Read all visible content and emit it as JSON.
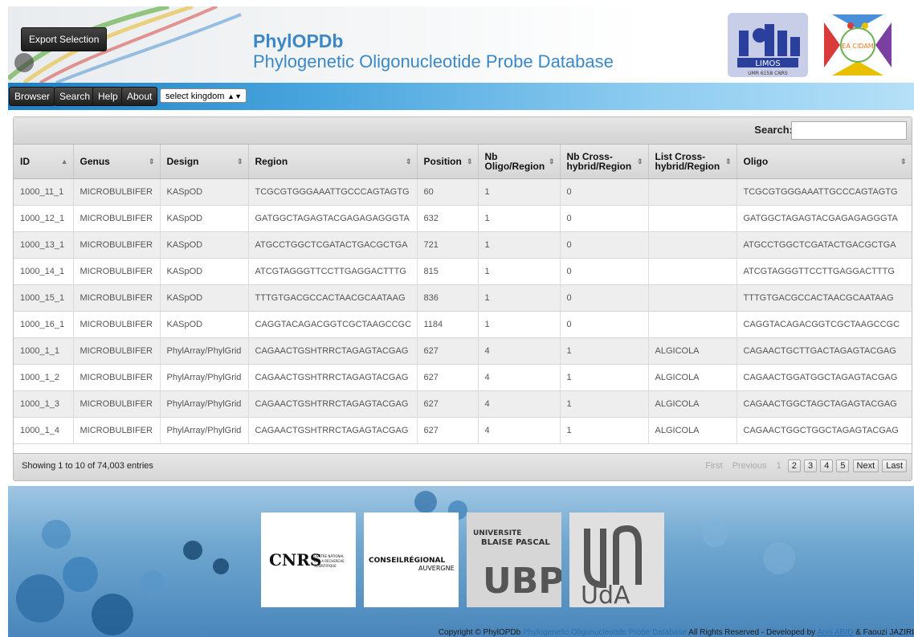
{
  "header": {
    "export_label": "Export Selection",
    "title": "PhylOPDb",
    "subtitle": "Phylogenetic Oligonucleotide Probe Database",
    "limos_text": "LIMOS",
    "limos_sub": "UMR 6158 CNRS",
    "ea_text": "EA CIDAM"
  },
  "nav": {
    "items": [
      "Browser",
      "Search",
      "Help",
      "About"
    ],
    "kingdom_select": "select kingdom"
  },
  "table": {
    "search_label": "Search:",
    "columns": [
      "ID",
      "Genus",
      "Design",
      "Region",
      "Position",
      "Nb Oligo/Region",
      "Nb Cross-hybrid/Region",
      "List Cross-hybrid/Region",
      "Oligo"
    ],
    "rows": [
      [
        "1000_11_1",
        "MICROBULBIFER",
        "KASpOD",
        "TCGCGTGGGAAATTGCCCAGTAGTG",
        "60",
        "1",
        "0",
        "",
        "TCGCGTGGGAAATTGCCCAGTAGTG"
      ],
      [
        "1000_12_1",
        "MICROBULBIFER",
        "KASpOD",
        "GATGGCTAGAGTACGAGAGAGGGTA",
        "632",
        "1",
        "0",
        "",
        "GATGGCTAGAGTACGAGAGAGGGTA"
      ],
      [
        "1000_13_1",
        "MICROBULBIFER",
        "KASpOD",
        "ATGCCTGGCTCGATACTGACGCTGA",
        "721",
        "1",
        "0",
        "",
        "ATGCCTGGCTCGATACTGACGCTGA"
      ],
      [
        "1000_14_1",
        "MICROBULBIFER",
        "KASpOD",
        "ATCGTAGGGTTCCTTGAGGACTTTG",
        "815",
        "1",
        "0",
        "",
        "ATCGTAGGGTTCCTTGAGGACTTTG"
      ],
      [
        "1000_15_1",
        "MICROBULBIFER",
        "KASpOD",
        "TTTGTGACGCCACTAACGCAATAAG",
        "836",
        "1",
        "0",
        "",
        "TTTGTGACGCCACTAACGCAATAAG"
      ],
      [
        "1000_16_1",
        "MICROBULBIFER",
        "KASpOD",
        "CAGGTACAGACGGTCGCTAAGCCGC",
        "1184",
        "1",
        "0",
        "",
        "CAGGTACAGACGGTCGCTAAGCCGC"
      ],
      [
        "1000_1_1",
        "MICROBULBIFER",
        "PhylArray/PhylGrid",
        "CAGAACTGSHTRRCTAGAGTACGAG",
        "627",
        "4",
        "1",
        "ALGICOLA",
        "CAGAACTGCTTGACTAGAGTACGAG"
      ],
      [
        "1000_1_2",
        "MICROBULBIFER",
        "PhylArray/PhylGrid",
        "CAGAACTGSHTRRCTAGAGTACGAG",
        "627",
        "4",
        "1",
        "ALGICOLA",
        "CAGAACTGGATGGCTAGAGTACGAG"
      ],
      [
        "1000_1_3",
        "MICROBULBIFER",
        "PhylArray/PhylGrid",
        "CAGAACTGSHTRRCTAGAGTACGAG",
        "627",
        "4",
        "1",
        "ALGICOLA",
        "CAGAACTGGCTAGCTAGAGTACGAG"
      ],
      [
        "1000_1_4",
        "MICROBULBIFER",
        "PhylArray/PhylGrid",
        "CAGAACTGSHTRRCTAGAGTACGAG",
        "627",
        "4",
        "1",
        "ALGICOLA",
        "CAGAACTGGCTGGCTAGAGTACGAG"
      ]
    ],
    "showing": "Showing 1 to 10 of 74,003 entries",
    "pager": {
      "first": "First",
      "previous": "Previous",
      "current": "1",
      "pages": [
        "2",
        "3",
        "4",
        "5"
      ],
      "next": "Next",
      "last": "Last"
    }
  },
  "footer": {
    "logos": [
      {
        "name": "CNRS",
        "text": "CNRS",
        "sub": "CENTRE NATIONAL DE LA RECHERCHE SCIENTIFIQUE"
      },
      {
        "name": "Conseil Regional Auvergne",
        "text": "CONSEILRÉGIONAL",
        "sub": "AUVERGNE"
      },
      {
        "name": "Universite Blaise Pascal",
        "text": "UNIVERSITE BLAISE PASCAL",
        "sub": "UBP"
      },
      {
        "name": "UdA",
        "text": "UdA"
      }
    ],
    "copyright_pre": "Copyright © PhylOPDb",
    "copyright_blue": "Phylogenetic Oligonucleotide Probe Database",
    "copyright_mid": "All Rights Reserved - Developed by",
    "author1": "Anis ABID",
    "copyright_and": "& Faouzi JAZIRI"
  },
  "colors": {
    "title_blue": "#3b88c8",
    "nav_blue": "#1f7fc4",
    "button_dark": "#1f1f1f"
  }
}
